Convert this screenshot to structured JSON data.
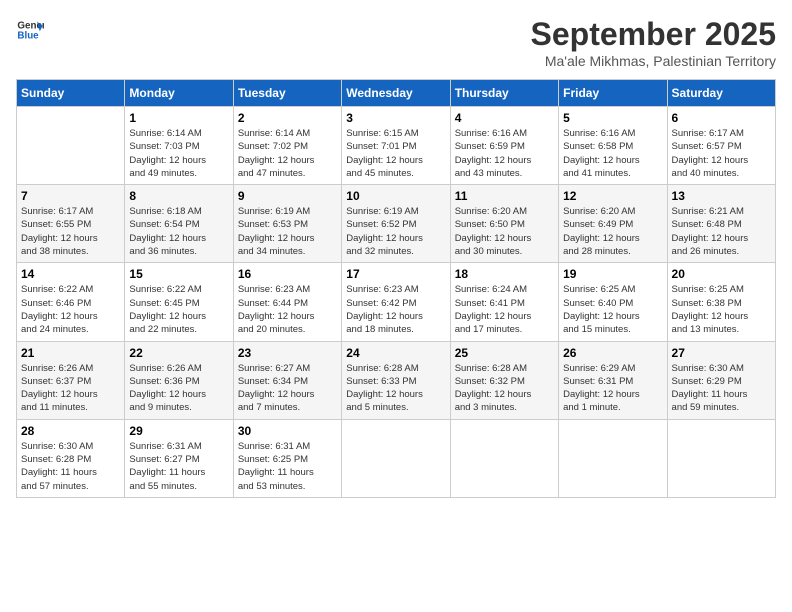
{
  "logo": {
    "line1": "General",
    "line2": "Blue"
  },
  "title": "September 2025",
  "location": "Ma'ale Mikhmas, Palestinian Territory",
  "days_of_week": [
    "Sunday",
    "Monday",
    "Tuesday",
    "Wednesday",
    "Thursday",
    "Friday",
    "Saturday"
  ],
  "weeks": [
    [
      {
        "day": "",
        "info": ""
      },
      {
        "day": "1",
        "info": "Sunrise: 6:14 AM\nSunset: 7:03 PM\nDaylight: 12 hours\nand 49 minutes."
      },
      {
        "day": "2",
        "info": "Sunrise: 6:14 AM\nSunset: 7:02 PM\nDaylight: 12 hours\nand 47 minutes."
      },
      {
        "day": "3",
        "info": "Sunrise: 6:15 AM\nSunset: 7:01 PM\nDaylight: 12 hours\nand 45 minutes."
      },
      {
        "day": "4",
        "info": "Sunrise: 6:16 AM\nSunset: 6:59 PM\nDaylight: 12 hours\nand 43 minutes."
      },
      {
        "day": "5",
        "info": "Sunrise: 6:16 AM\nSunset: 6:58 PM\nDaylight: 12 hours\nand 41 minutes."
      },
      {
        "day": "6",
        "info": "Sunrise: 6:17 AM\nSunset: 6:57 PM\nDaylight: 12 hours\nand 40 minutes."
      }
    ],
    [
      {
        "day": "7",
        "info": "Sunrise: 6:17 AM\nSunset: 6:55 PM\nDaylight: 12 hours\nand 38 minutes."
      },
      {
        "day": "8",
        "info": "Sunrise: 6:18 AM\nSunset: 6:54 PM\nDaylight: 12 hours\nand 36 minutes."
      },
      {
        "day": "9",
        "info": "Sunrise: 6:19 AM\nSunset: 6:53 PM\nDaylight: 12 hours\nand 34 minutes."
      },
      {
        "day": "10",
        "info": "Sunrise: 6:19 AM\nSunset: 6:52 PM\nDaylight: 12 hours\nand 32 minutes."
      },
      {
        "day": "11",
        "info": "Sunrise: 6:20 AM\nSunset: 6:50 PM\nDaylight: 12 hours\nand 30 minutes."
      },
      {
        "day": "12",
        "info": "Sunrise: 6:20 AM\nSunset: 6:49 PM\nDaylight: 12 hours\nand 28 minutes."
      },
      {
        "day": "13",
        "info": "Sunrise: 6:21 AM\nSunset: 6:48 PM\nDaylight: 12 hours\nand 26 minutes."
      }
    ],
    [
      {
        "day": "14",
        "info": "Sunrise: 6:22 AM\nSunset: 6:46 PM\nDaylight: 12 hours\nand 24 minutes."
      },
      {
        "day": "15",
        "info": "Sunrise: 6:22 AM\nSunset: 6:45 PM\nDaylight: 12 hours\nand 22 minutes."
      },
      {
        "day": "16",
        "info": "Sunrise: 6:23 AM\nSunset: 6:44 PM\nDaylight: 12 hours\nand 20 minutes."
      },
      {
        "day": "17",
        "info": "Sunrise: 6:23 AM\nSunset: 6:42 PM\nDaylight: 12 hours\nand 18 minutes."
      },
      {
        "day": "18",
        "info": "Sunrise: 6:24 AM\nSunset: 6:41 PM\nDaylight: 12 hours\nand 17 minutes."
      },
      {
        "day": "19",
        "info": "Sunrise: 6:25 AM\nSunset: 6:40 PM\nDaylight: 12 hours\nand 15 minutes."
      },
      {
        "day": "20",
        "info": "Sunrise: 6:25 AM\nSunset: 6:38 PM\nDaylight: 12 hours\nand 13 minutes."
      }
    ],
    [
      {
        "day": "21",
        "info": "Sunrise: 6:26 AM\nSunset: 6:37 PM\nDaylight: 12 hours\nand 11 minutes."
      },
      {
        "day": "22",
        "info": "Sunrise: 6:26 AM\nSunset: 6:36 PM\nDaylight: 12 hours\nand 9 minutes."
      },
      {
        "day": "23",
        "info": "Sunrise: 6:27 AM\nSunset: 6:34 PM\nDaylight: 12 hours\nand 7 minutes."
      },
      {
        "day": "24",
        "info": "Sunrise: 6:28 AM\nSunset: 6:33 PM\nDaylight: 12 hours\nand 5 minutes."
      },
      {
        "day": "25",
        "info": "Sunrise: 6:28 AM\nSunset: 6:32 PM\nDaylight: 12 hours\nand 3 minutes."
      },
      {
        "day": "26",
        "info": "Sunrise: 6:29 AM\nSunset: 6:31 PM\nDaylight: 12 hours\nand 1 minute."
      },
      {
        "day": "27",
        "info": "Sunrise: 6:30 AM\nSunset: 6:29 PM\nDaylight: 11 hours\nand 59 minutes."
      }
    ],
    [
      {
        "day": "28",
        "info": "Sunrise: 6:30 AM\nSunset: 6:28 PM\nDaylight: 11 hours\nand 57 minutes."
      },
      {
        "day": "29",
        "info": "Sunrise: 6:31 AM\nSunset: 6:27 PM\nDaylight: 11 hours\nand 55 minutes."
      },
      {
        "day": "30",
        "info": "Sunrise: 6:31 AM\nSunset: 6:25 PM\nDaylight: 11 hours\nand 53 minutes."
      },
      {
        "day": "",
        "info": ""
      },
      {
        "day": "",
        "info": ""
      },
      {
        "day": "",
        "info": ""
      },
      {
        "day": "",
        "info": ""
      }
    ]
  ]
}
